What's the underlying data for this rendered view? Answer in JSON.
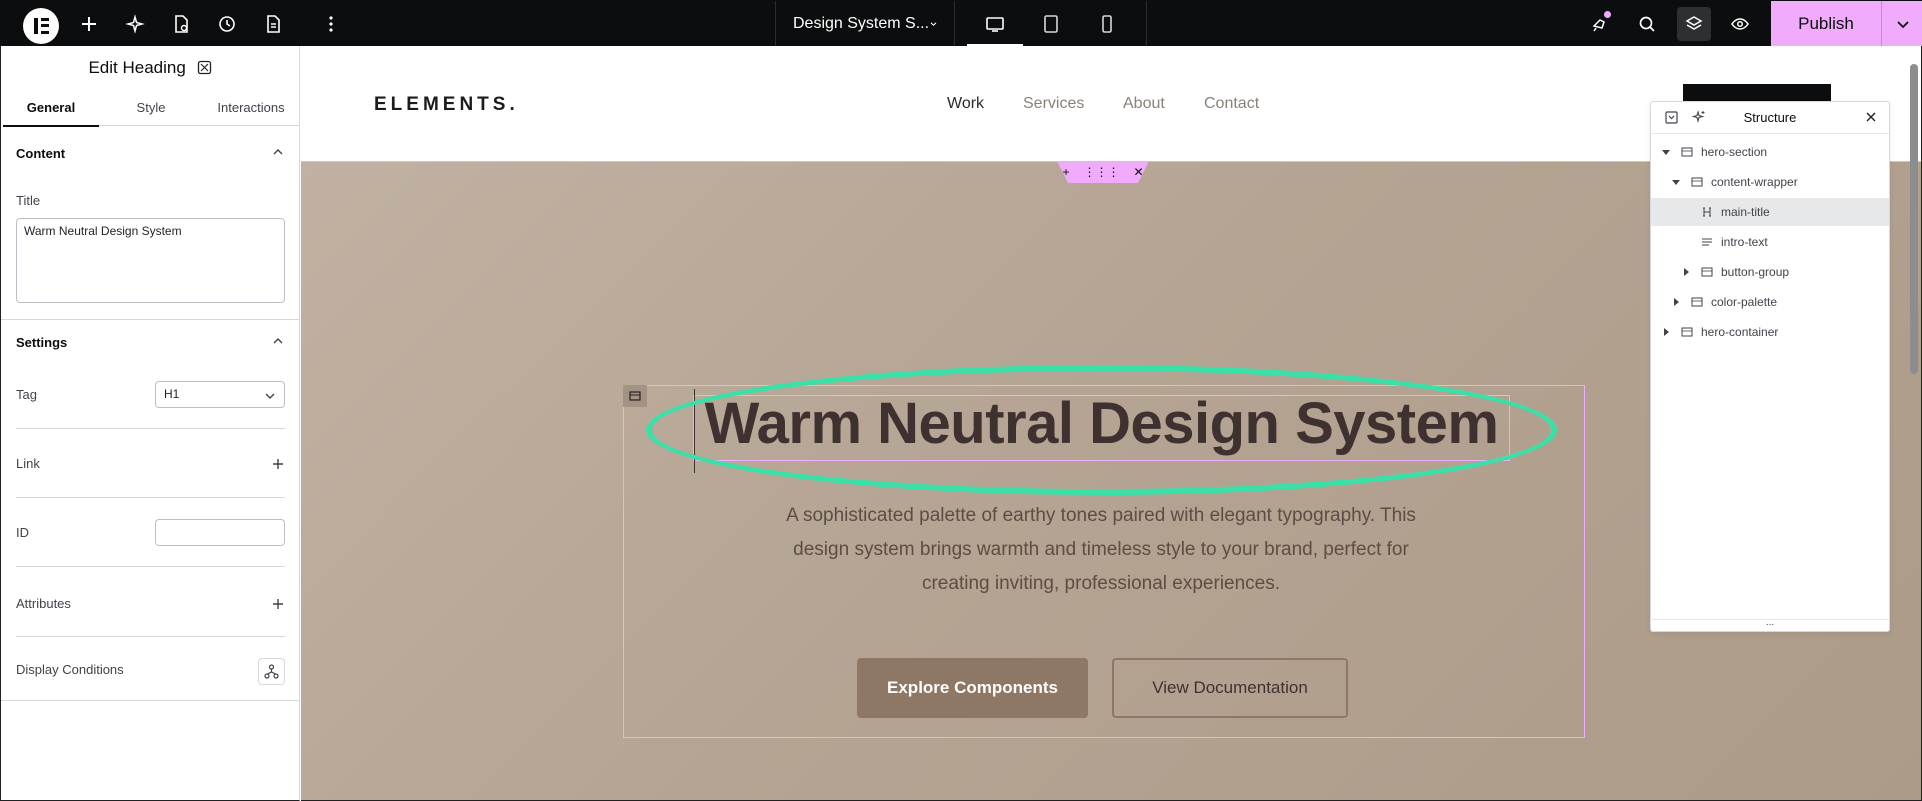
{
  "topbar": {
    "doc_title": "Design System S...",
    "publish_label": "Publish"
  },
  "panel": {
    "title": "Edit Heading",
    "tabs": [
      "General",
      "Style",
      "Interactions"
    ],
    "content_section": "Content",
    "title_label": "Title",
    "title_value": "Warm Neutral Design System",
    "settings_section": "Settings",
    "tag_label": "Tag",
    "tag_value": "H1",
    "link_label": "Link",
    "id_label": "ID",
    "id_value": "",
    "attributes_label": "Attributes",
    "display_conditions_label": "Display Conditions"
  },
  "site": {
    "brand": "ELEMENTS.",
    "nav": [
      "Work",
      "Services",
      "About",
      "Contact"
    ],
    "heading": "Warm Neutral Design System",
    "intro_lines": [
      "A sophisticated palette of earthy tones paired with elegant typography. This",
      "design system brings warmth and timeless style to your brand, perfect for",
      "creating inviting, professional experiences."
    ],
    "primary_button": "Explore Components",
    "secondary_button": "View Documentation"
  },
  "structure": {
    "title": "Structure",
    "items": [
      {
        "label": "hero-section"
      },
      {
        "label": "content-wrapper"
      },
      {
        "label": "main-title"
      },
      {
        "label": "intro-text"
      },
      {
        "label": "button-group"
      },
      {
        "label": "color-palette"
      },
      {
        "label": "hero-container"
      }
    ],
    "footer": "..."
  },
  "colors": {
    "accent": "#f0abfc",
    "annotation": "#3be0a8",
    "hero_bg": "#b5a493",
    "button_primary": "#8e7765",
    "heading_text": "#3e3130"
  }
}
